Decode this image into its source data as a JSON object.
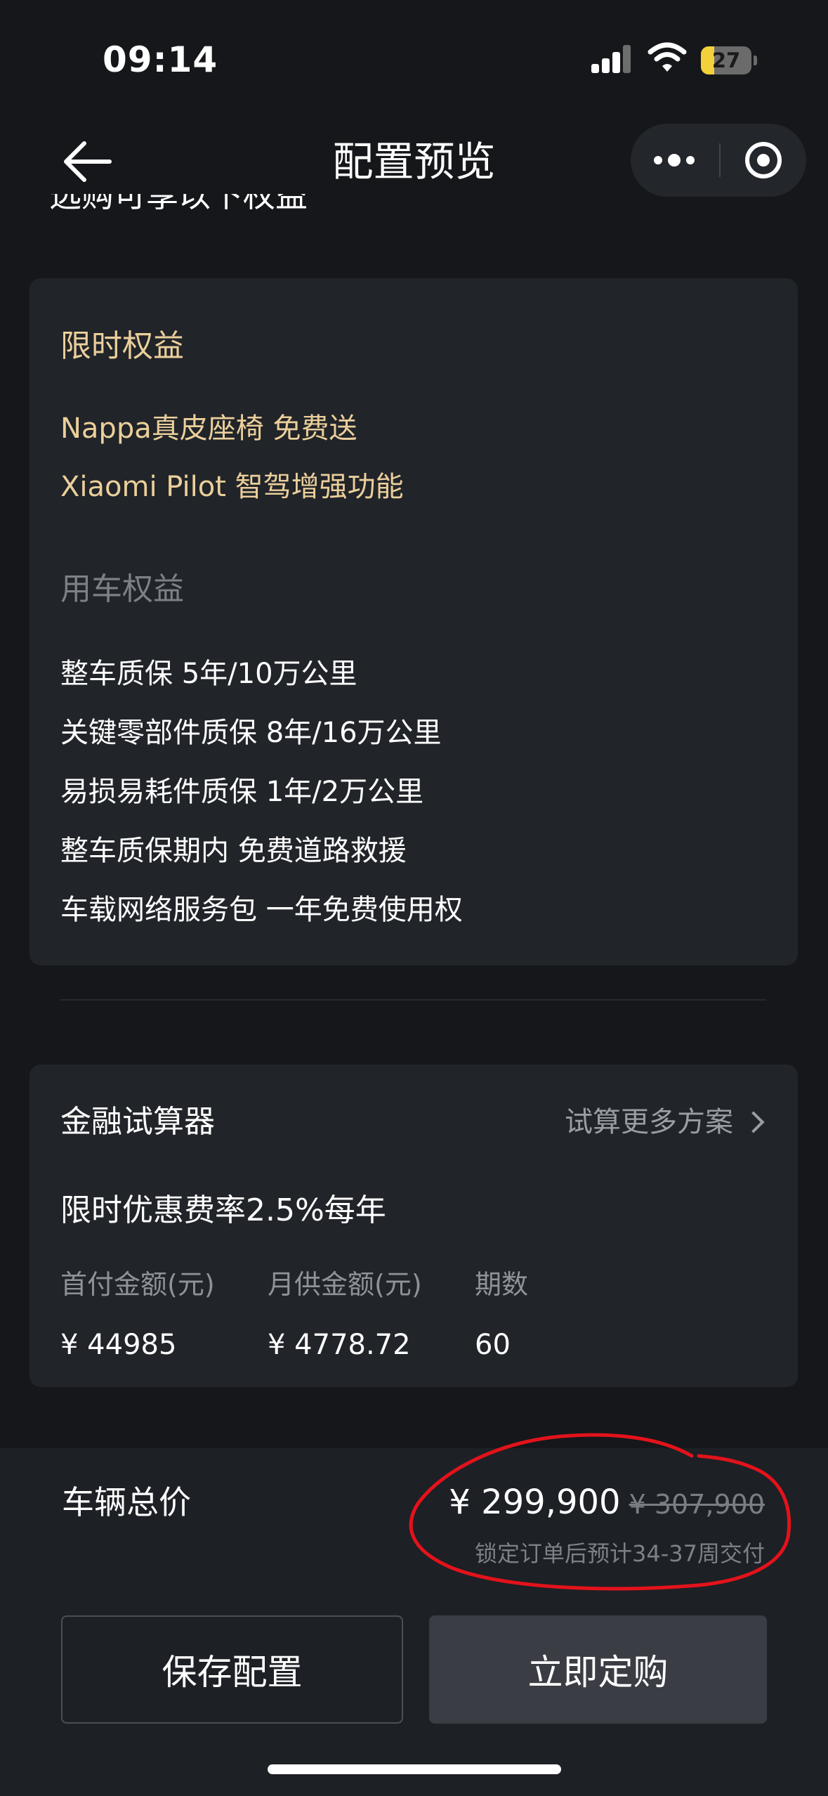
{
  "status_bar": {
    "time": "09:14",
    "battery": "27",
    "battery_level": 0.27
  },
  "nav": {
    "title": "配置预览",
    "clipped_heading": "选购可享以下权益"
  },
  "limited_benefits": {
    "title": "限时权益",
    "items": [
      "Nappa真皮座椅 免费送",
      "Xiaomi Pilot 智驾增强功能"
    ]
  },
  "vehicle_benefits": {
    "title": "用车权益",
    "items": [
      "整车质保 5年/10万公里",
      "关键零部件质保 8年/16万公里",
      "易损易耗件质保 1年/2万公里",
      "整车质保期内 免费道路救援",
      "车载网络服务包 一年免费使用权"
    ]
  },
  "finance": {
    "title": "金融试算器",
    "more_link": "试算更多方案",
    "rate": "限时优惠费率2.5%每年",
    "columns": [
      {
        "label": "首付金额(元)",
        "value": "¥ 44985"
      },
      {
        "label": "月供金额(元)",
        "value": "¥ 4778.72"
      },
      {
        "label": "期数",
        "value": "60"
      }
    ]
  },
  "summary": {
    "label": "车辆总价",
    "price": "¥ 299,900",
    "original_price": "¥ 307,900",
    "delivery": "锁定订单后预计34-37周交付"
  },
  "actions": {
    "save": "保存配置",
    "order": "立即定购"
  },
  "colors": {
    "accent_gold": "#ebcf9b",
    "annotation_red": "#e3121b",
    "background": "#15171a",
    "card": "#212429"
  }
}
